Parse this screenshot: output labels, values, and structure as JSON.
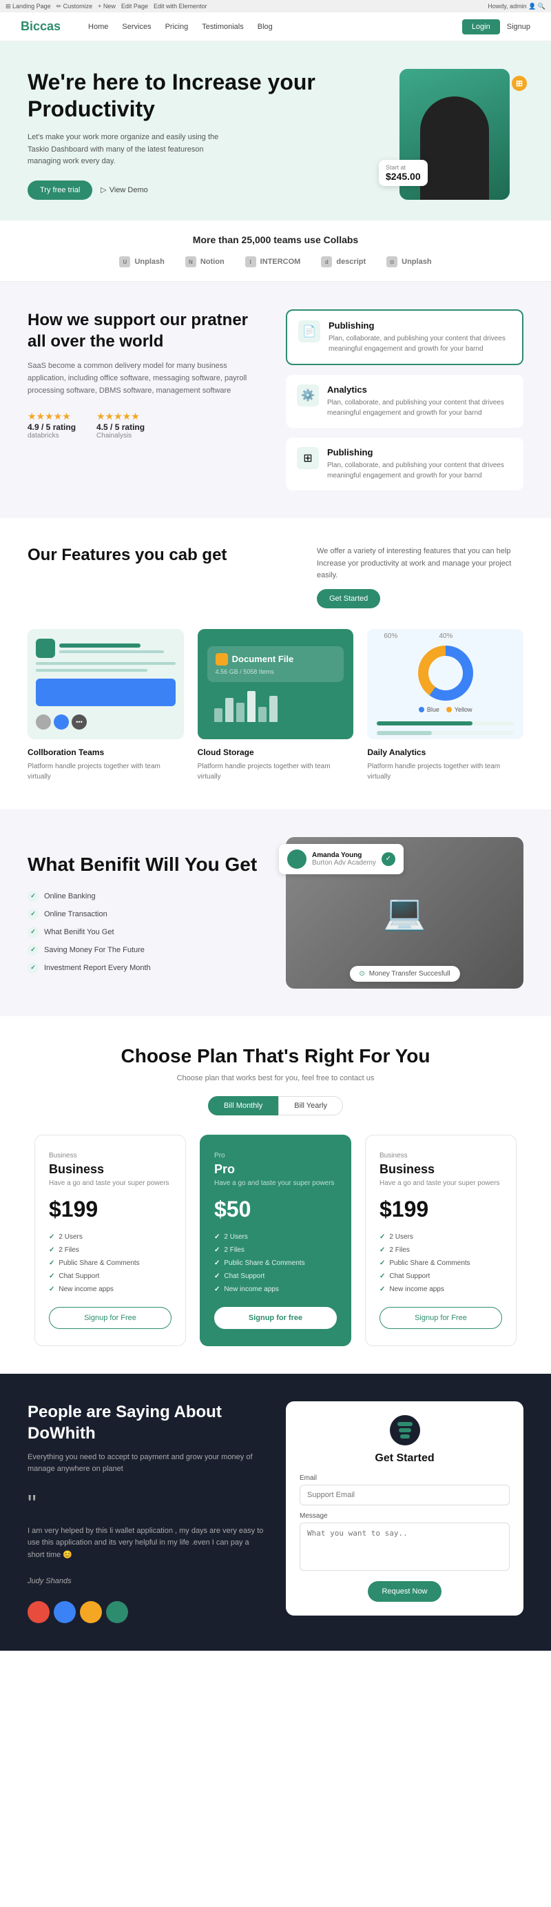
{
  "topbar": {
    "items": [
      "Landing Page",
      "Customize",
      "New",
      "Edit Page",
      "Edit with Elementor",
      "Howdy, admin"
    ]
  },
  "nav": {
    "logo": "Biccas",
    "links": [
      "Home",
      "Services",
      "Pricing",
      "Testimonials",
      "Blog"
    ],
    "login": "Login",
    "signup": "Signup"
  },
  "hero": {
    "headline": "We're here to Increase your Productivity",
    "description": "Let's make your work more organize and easily using the Taskio Dashboard with many of the latest featureson managing work every day.",
    "btn_trial": "Try free trial",
    "btn_demo": "View Demo",
    "price_label": "Start at",
    "price": "$245.00",
    "notification": "!"
  },
  "trusted": {
    "headline": "More than 25,000 teams use Collabs",
    "logos": [
      "Unplash",
      "Notion",
      "INTERCOM",
      "descript",
      "Unplash"
    ]
  },
  "support": {
    "title": "How we support our pratner all over the world",
    "description": "SaaS become a common delivery model for many business application, including office software, messaging software, payroll processing software, DBMS software, management software",
    "ratings": [
      {
        "stars": "★★★★★",
        "score": "4.9 / 5 rating",
        "source": "databricks"
      },
      {
        "stars": "★★★★★",
        "score": "4.5 / 5 rating",
        "source": "Chainalysis"
      }
    ],
    "features": [
      {
        "icon": "📄",
        "title": "Publishing",
        "description": "Plan, collaborate, and publishing your content that drivees meaningful engagement and growth for your barnd"
      },
      {
        "icon": "⚙️",
        "title": "Analytics",
        "description": "Plan, collaborate, and publishing your content that drivees meaningful engagement and growth for your barnd"
      },
      {
        "icon": "⊞",
        "title": "Publishing",
        "description": "Plan, collaborate, and publishing your content that drivees meaningful engagement and growth for your barnd"
      }
    ]
  },
  "features": {
    "title": "Our Features you cab get",
    "description": "We offer a variety of interesting features that you can help Increase yor productivity at work and manage your project easily.",
    "btn": "Get Started",
    "items": [
      {
        "name": "Collboration Teams",
        "description": "Platform handle projects together with team virtually"
      },
      {
        "name": "Cloud Storage",
        "description": "Platform handle projects together with team virtually"
      },
      {
        "name": "Daily Analytics",
        "description": "Platform handle projects together with team virtually"
      }
    ],
    "cloud_file": "Document File",
    "cloud_size": "4.56 GB / 5058 Items"
  },
  "benefit": {
    "title": "What Benifit Will You Get",
    "items": [
      "Online Banking",
      "Online Transaction",
      "What Benifit You Get",
      "Saving Money For The Future",
      "Investment Report Every Month"
    ],
    "user_name": "Amanda Young",
    "user_role": "Burton Adv Academy",
    "transfer": "Money Transfer Succesfull"
  },
  "pricing": {
    "title": "Choose Plan That's Right For You",
    "subtitle": "Choose plan that works best for you, feel free to contact us",
    "toggle_monthly": "Bill Monthly",
    "toggle_yearly": "Bill Yearly",
    "plans": [
      {
        "type": "Business",
        "name": "Business",
        "description": "Have a go and taste your super powers",
        "price": "$199",
        "features": [
          "2 Users",
          "2 Files",
          "Public Share & Comments",
          "Chat Support",
          "New income apps"
        ],
        "btn": "Signup for Free",
        "featured": false
      },
      {
        "type": "Pro",
        "name": "Pro",
        "description": "Have a go and taste your super powers",
        "price": "$50",
        "features": [
          "2 Users",
          "2 Files",
          "Public Share & Comments",
          "Chat Support",
          "New income apps"
        ],
        "btn": "Signup for free",
        "featured": true
      },
      {
        "type": "Business",
        "name": "Business",
        "description": "Have a go and taste your super powers",
        "price": "$199",
        "features": [
          "2 Users",
          "2 Files",
          "Public Share & Comments",
          "Chat Support",
          "New income apps"
        ],
        "btn": "Signup for Free",
        "featured": false
      }
    ]
  },
  "testimonials": {
    "title": "People are Saying About DoWhith",
    "description": "Everything you need to accept to payment and grow your money of manage anywhere on planet",
    "quote": "I am very helped by this li wallet application , my days are very easy to use this application and its very helpful in my life .even I can pay a short time 😊",
    "author": "Judy Shands",
    "get_started_title": "Get Started",
    "form": {
      "email_label": "Email",
      "email_placeholder": "Support Email",
      "message_label": "Message",
      "message_placeholder": "What you want to say..",
      "btn": "Request Now"
    }
  },
  "colors": {
    "primary": "#2d8c6e",
    "dark": "#1a1f2e",
    "light_bg": "#e8f5f0"
  }
}
